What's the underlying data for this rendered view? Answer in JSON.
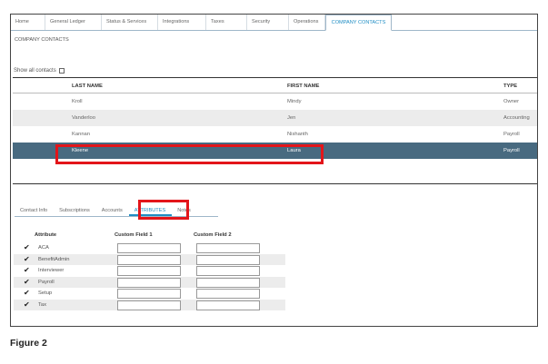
{
  "top_tabs": [
    {
      "label": "Home"
    },
    {
      "label": "General Ledger"
    },
    {
      "label": "Status & Services"
    },
    {
      "label": "Integrations"
    },
    {
      "label": "Taxes"
    },
    {
      "label": "Security"
    },
    {
      "label": "Operations"
    },
    {
      "label": "COMPANY CONTACTS",
      "active": true
    }
  ],
  "section_title": "COMPANY CONTACTS",
  "show_all_label": "Show all contacts",
  "contacts": {
    "headers": {
      "last": "LAST NAME",
      "first": "FIRST NAME",
      "type": "TYPE"
    },
    "rows": [
      {
        "last": "Kroll",
        "first": "Mindy",
        "type": "Owner"
      },
      {
        "last": "Vanderloo",
        "first": "Jen",
        "type": "Accounting"
      },
      {
        "last": "Kannan",
        "first": "Nishanth",
        "type": "Payroll"
      },
      {
        "last": "Kleene",
        "first": "Laura",
        "type": "Payroll",
        "selected": true
      }
    ]
  },
  "sub_tabs": [
    {
      "label": "Contact Info"
    },
    {
      "label": "Subscriptions"
    },
    {
      "label": "Accounts"
    },
    {
      "label": "ATTRIBUTES",
      "active": true
    },
    {
      "label": "Notes"
    }
  ],
  "attributes": {
    "headers": {
      "attribute": "Attribute",
      "field1": "Custom Field 1",
      "field2": "Custom Field 2"
    },
    "check_glyph": "✔",
    "rows": [
      {
        "name": "ACA",
        "field1": "",
        "field2": ""
      },
      {
        "name": "BenefitAdmin",
        "field1": "",
        "field2": ""
      },
      {
        "name": "Interviewer",
        "field1": "",
        "field2": ""
      },
      {
        "name": "Payroll",
        "field1": "",
        "field2": ""
      },
      {
        "name": "Setup",
        "field1": "",
        "field2": ""
      },
      {
        "name": "Tax",
        "field1": "",
        "field2": ""
      }
    ]
  },
  "caption": "Figure 2",
  "colors": {
    "accent": "#1f8dc4",
    "selected_row": "#486a80",
    "highlight": "#e3151a"
  }
}
